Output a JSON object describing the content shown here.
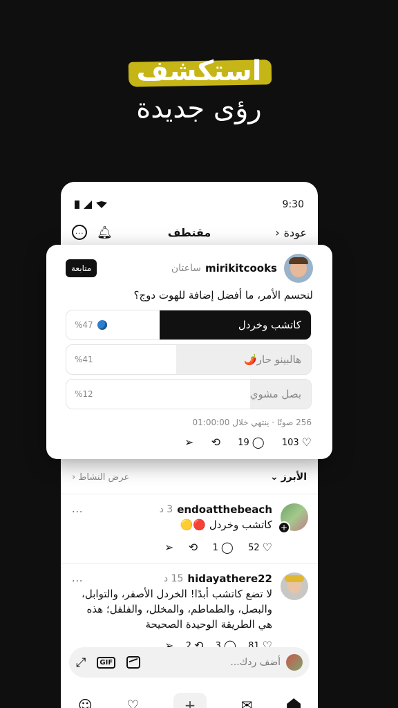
{
  "hero": {
    "highlight": "استكشف",
    "subtitle": "رؤى جديدة",
    "highlight_color": "#c6b516"
  },
  "status_bar": {
    "time": "9:30"
  },
  "nav": {
    "title": "مقتطف",
    "back_label": "عودة"
  },
  "post": {
    "username": "mirikitcooks",
    "time": "ساعتان",
    "follow_label": "متابعة",
    "question": "لنحسم الأمر، ما أفضل إضافة للهوت دوج؟",
    "options": [
      {
        "label": "كاتشب وخردل",
        "percent": "%47",
        "fill": 0.62,
        "selected": true
      },
      {
        "label": "هالبينو حار🌶️",
        "percent": "%41",
        "fill": 0.55,
        "selected": false
      },
      {
        "label": "بصل مشوي",
        "percent": "%12",
        "fill": 0.25,
        "selected": false
      }
    ],
    "meta": "256 صوتًا · ينتهي خلال 01:00:00",
    "likes": "103",
    "replies": "19"
  },
  "activity": {
    "top_label": "الأبرز",
    "view_label": "عرض النشاط"
  },
  "comments": [
    {
      "username": "endoatthebeach",
      "time": "3 د",
      "text": "كاتشب وخردل 🔴🟡",
      "likes": "52",
      "replies": "1",
      "reposts": ""
    },
    {
      "username": "hidayathere22",
      "time": "15 د",
      "text": "لا تضع كاتشب أبدًا! الخردل الأصفر، والتوابل، والبصل، والطماطم، والمخلل، والفلفل؛ هذه هي الطريقة الوحيدة الصحيحة",
      "likes": "81",
      "replies": "3",
      "reposts": "2"
    }
  ],
  "composer": {
    "placeholder": "أضف ردك...",
    "gif_label": "GIF"
  },
  "icons": {
    "more": "...",
    "plus": "+",
    "back": "‹",
    "chevron_down": "⌄",
    "chevron_left": "‹"
  }
}
